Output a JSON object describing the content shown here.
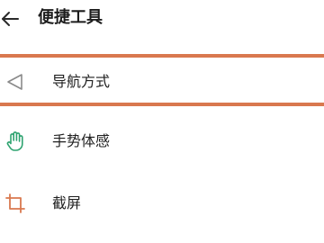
{
  "header": {
    "title": "便捷工具",
    "back_icon": "arrow-left-icon"
  },
  "menu": {
    "items": [
      {
        "label": "导航方式",
        "icon": "navigation-triangle-icon",
        "highlighted": true
      },
      {
        "label": "手势体感",
        "icon": "hand-gesture-icon",
        "icon_color": "#2ea370"
      },
      {
        "label": "截屏",
        "icon": "crop-icon",
        "icon_color": "#d9784f"
      }
    ]
  },
  "colors": {
    "highlight": "#d9784f",
    "gesture_icon": "#2ea370",
    "crop_icon": "#d9784f",
    "text": "#1f1f1f"
  }
}
